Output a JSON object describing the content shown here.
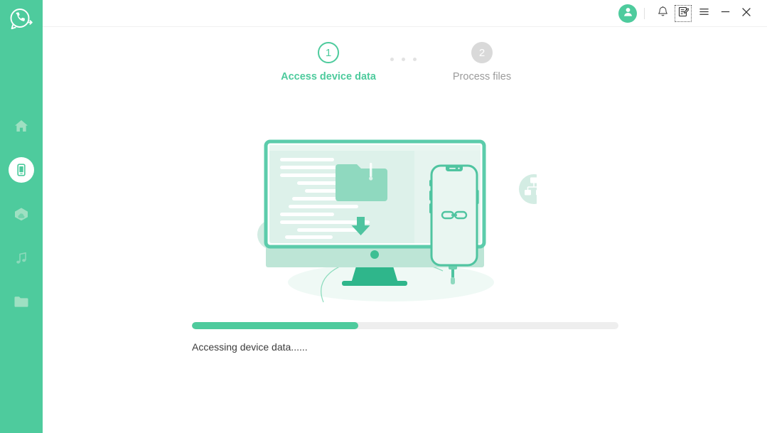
{
  "app": {
    "brand_icon": "whatsapp-transfer-logo",
    "accent_color": "#4ECB9D",
    "pending_color": "#d9d9d9"
  },
  "sidebar": {
    "items": [
      {
        "name": "home",
        "icon": "home-icon",
        "active": false
      },
      {
        "name": "device",
        "icon": "phone-icon",
        "active": true
      },
      {
        "name": "backup",
        "icon": "cloud-backup-icon",
        "active": false
      },
      {
        "name": "music",
        "icon": "music-note-icon",
        "active": false
      },
      {
        "name": "files",
        "icon": "folder-icon",
        "active": false
      }
    ]
  },
  "titlebar": {
    "avatar_icon": "user-avatar-icon",
    "notification_icon": "bell-icon",
    "feedback_icon": "feedback-edit-icon",
    "menu_icon": "hamburger-menu-icon",
    "minimize_icon": "minimize-icon",
    "close_icon": "close-icon"
  },
  "steps": {
    "items": [
      {
        "number": "1",
        "label": "Access device data",
        "state": "current"
      },
      {
        "number": "2",
        "label": "Process files",
        "state": "pending"
      }
    ],
    "connector_dots": 3
  },
  "illustration": {
    "name": "device-to-computer-transfer-illustration",
    "badges": [
      {
        "name": "bar-chart-badge-icon"
      },
      {
        "name": "briefcase-badge-icon"
      },
      {
        "name": "sitemap-badge-icon"
      }
    ],
    "monitor_icons": [
      "folder-icon",
      "download-arrow-icon"
    ],
    "phone_icon": "link-chain-icon"
  },
  "progress": {
    "percent": 39,
    "percent_label": "39%",
    "status_text": "Accessing device data......"
  }
}
